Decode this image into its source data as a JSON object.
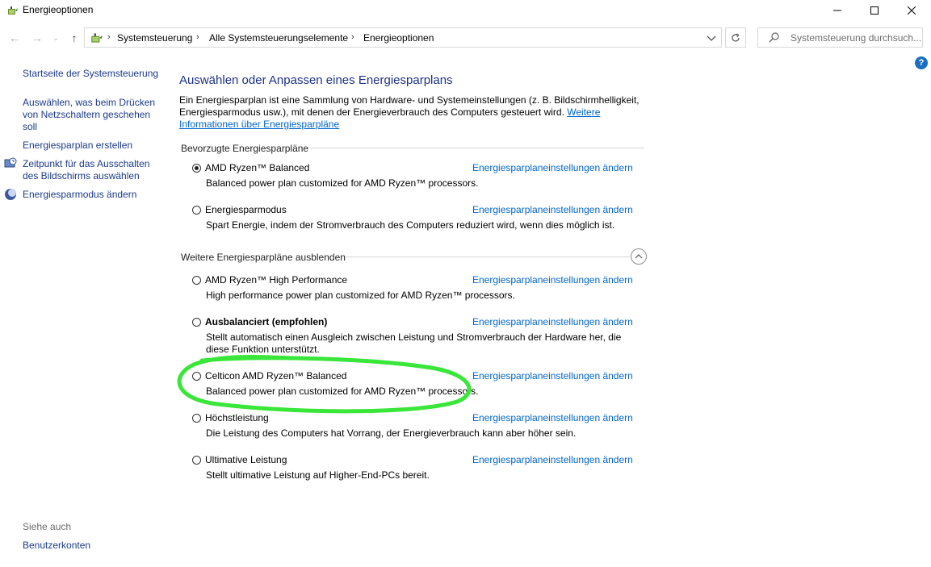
{
  "window": {
    "title": "Energieoptionen",
    "icon": "power-options-icon",
    "controls": [
      "minimize-icon",
      "maximize-icon",
      "close-icon"
    ]
  },
  "address_bar": {
    "breadcrumbs": [
      "Systemsteuerung",
      "Alle Systemsteuerungselemente",
      "Energieoptionen"
    ],
    "search_placeholder": "Systemsteuerung durchsuch..."
  },
  "sidebar": {
    "home_link": "Startseite der Systemsteuerung",
    "links": [
      {
        "label": "Auswählen, was beim Drücken von Netzschaltern geschehen soll",
        "icon": ""
      },
      {
        "label": "Energiesparplan erstellen",
        "icon": ""
      },
      {
        "label": "Zeitpunkt für das Ausschalten des Bildschirms auswählen",
        "icon": "monitor-clock-icon"
      },
      {
        "label": "Energiesparmodus ändern",
        "icon": "moon-icon"
      }
    ],
    "see_also_label": "Siehe auch",
    "see_also_links": [
      "Benutzerkonten"
    ]
  },
  "main": {
    "heading": "Auswählen oder Anpassen eines Energiesparplans",
    "intro_text": "Ein Energiesparplan ist eine Sammlung von Hardware- und Systemeinstellungen (z. B. Bildschirmhelligkeit, Energiesparmodus usw.), mit denen der Energieverbrauch des Computers gesteuert wird.",
    "intro_link": "Weitere Informationen über Energiesparpläne",
    "preferred_header": "Bevorzugte Energiesparpläne",
    "more_header": "Weitere Energiesparpläne ausblenden",
    "change_link_label": "Energiesparplaneinstellungen ändern",
    "preferred_plans": [
      {
        "name": "AMD Ryzen™ Balanced",
        "desc": "Balanced power plan customized for AMD Ryzen™ processors.",
        "selected": true,
        "bold": false
      },
      {
        "name": "Energiesparmodus",
        "desc": "Spart Energie, indem der Stromverbrauch des Computers reduziert wird, wenn dies möglich ist.",
        "selected": false,
        "bold": false
      }
    ],
    "more_plans": [
      {
        "name": "AMD Ryzen™ High Performance",
        "desc": "High performance power plan customized for AMD Ryzen™ processors.",
        "selected": false,
        "bold": false
      },
      {
        "name": "Ausbalanciert (empfohlen)",
        "desc": "Stellt automatisch einen Ausgleich zwischen Leistung und Stromverbrauch der Hardware her, die diese Funktion unterstützt.",
        "selected": false,
        "bold": true
      },
      {
        "name": "Celticon AMD Ryzen™ Balanced",
        "desc": "Balanced power plan customized for AMD Ryzen™ processors.",
        "selected": false,
        "bold": false
      },
      {
        "name": "Höchstleistung",
        "desc": "Die Leistung des Computers hat Vorrang, der Energieverbrauch kann aber höher sein.",
        "selected": false,
        "bold": false
      },
      {
        "name": "Ultimative Leistung",
        "desc": "Stellt ultimative Leistung auf Higher-End-PCs bereit.",
        "selected": false,
        "bold": false
      }
    ]
  },
  "annotation": {
    "color": "#39e639",
    "target": "Celticon AMD Ryzen™ Balanced"
  }
}
